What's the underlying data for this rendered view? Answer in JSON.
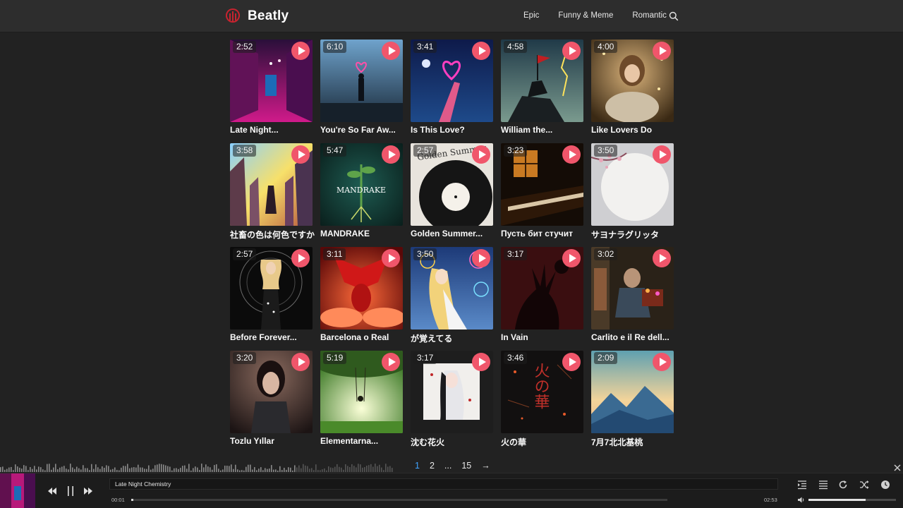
{
  "app": {
    "name": "Beatly",
    "accent": "#f0566b"
  },
  "nav": [
    {
      "label": "Epic"
    },
    {
      "label": "Funny & Meme"
    },
    {
      "label": "Romantic"
    }
  ],
  "search": {
    "icon": "search-icon"
  },
  "songs": [
    {
      "title": "Late Night...",
      "duration": "2:52"
    },
    {
      "title": "You're So Far Aw...",
      "duration": "6:10"
    },
    {
      "title": "Is This Love?",
      "duration": "3:41"
    },
    {
      "title": "William the...",
      "duration": "4:58"
    },
    {
      "title": "Like Lovers Do",
      "duration": "4:00"
    },
    {
      "title": "社畜の色は何色ですか",
      "duration": "3:58"
    },
    {
      "title": "MANDRAKE",
      "duration": "5:47"
    },
    {
      "title": "Golden Summer...",
      "duration": "2:57"
    },
    {
      "title": "Пусть бит стучит",
      "duration": "3:23"
    },
    {
      "title": "サヨナラグリッタ",
      "duration": "3:50"
    },
    {
      "title": "Before Forever...",
      "duration": "2:57"
    },
    {
      "title": "Barcelona o Real",
      "duration": "3:11"
    },
    {
      "title": "が覚えてる",
      "duration": "3:50"
    },
    {
      "title": "In Vain",
      "duration": "3:17"
    },
    {
      "title": "Carlito e il Re dell...",
      "duration": "3:02"
    },
    {
      "title": "Tozlu Yıllar",
      "duration": "3:20"
    },
    {
      "title": "Elementarna...",
      "duration": "5:19"
    },
    {
      "title": "沈む花火",
      "duration": "3:17"
    },
    {
      "title": "火の華",
      "duration": "3:46"
    },
    {
      "title": "7月7北北基桃",
      "duration": "2:09"
    }
  ],
  "artwork_text": {
    "mandrake": "MANDRAKE",
    "golden": "Golden Summer",
    "hinohana": "火の華"
  },
  "pagination": {
    "pages": [
      "1",
      "2",
      "...",
      "15"
    ],
    "current": "1",
    "next": "→"
  },
  "player": {
    "track_title": "Late Night Chemistry",
    "elapsed": "00:01",
    "duration": "02:53",
    "progress": 0.004,
    "volume": 0.65
  }
}
